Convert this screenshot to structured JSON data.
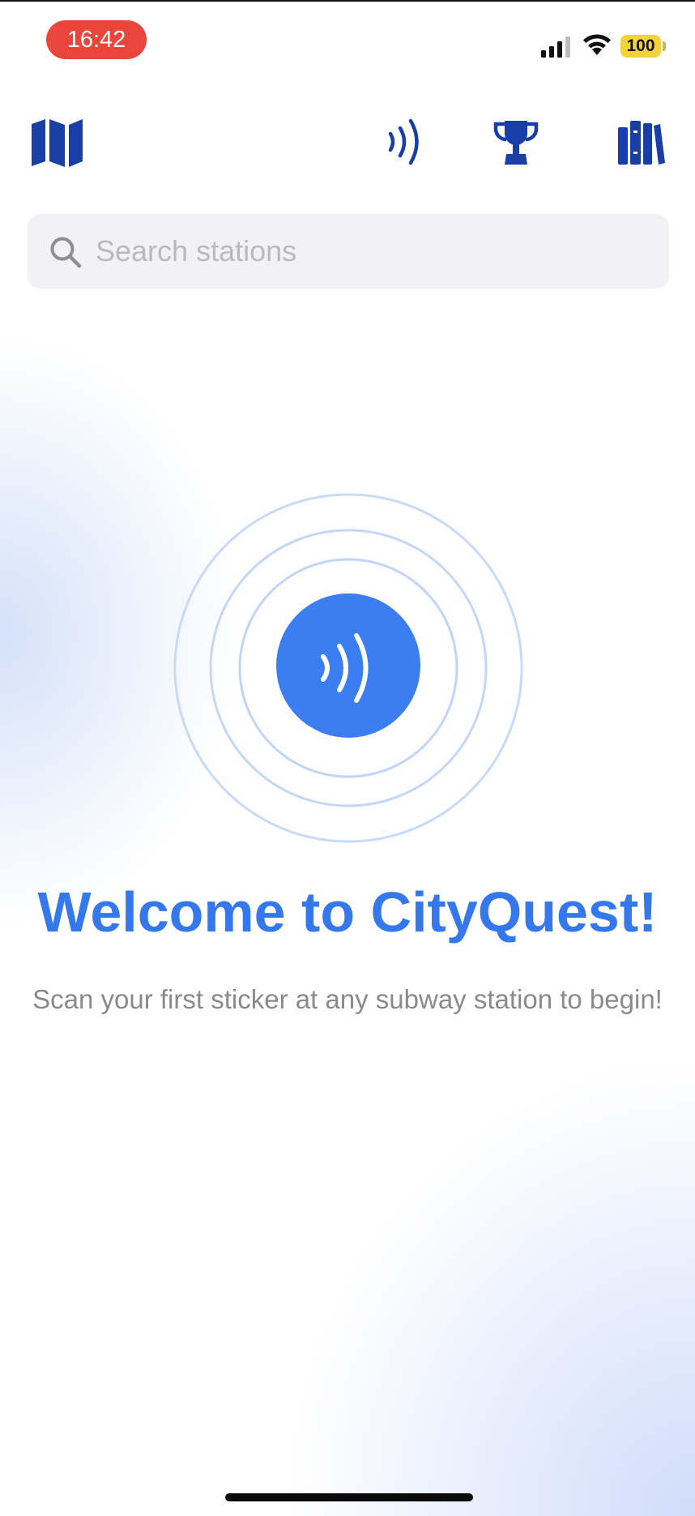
{
  "status_bar": {
    "time": "16:42",
    "battery": "100",
    "time_pill_color": "#e9453a",
    "battery_color": "#f4d23c"
  },
  "nav": {
    "icons": [
      "map-icon",
      "nfc-scan-icon",
      "trophy-icon",
      "library-icon"
    ],
    "icon_color": "#1a3ea8"
  },
  "search": {
    "placeholder": "Search stations",
    "value": ""
  },
  "main": {
    "scan_icon": "nfc-wave-icon",
    "accent_color": "#3a7ef2",
    "welcome_title": "Welcome to CityQuest!",
    "subtitle": "Scan your first sticker at any subway station to begin!"
  }
}
